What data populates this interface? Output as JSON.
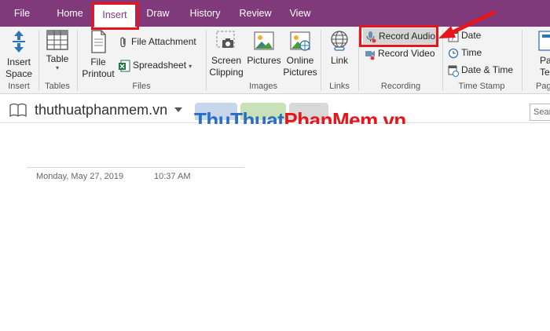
{
  "tabs": [
    {
      "label": "File"
    },
    {
      "label": "Home"
    },
    {
      "label": "Insert"
    },
    {
      "label": "Draw"
    },
    {
      "label": "History"
    },
    {
      "label": "Review"
    },
    {
      "label": "View"
    }
  ],
  "ribbon": {
    "insert_space": "Insert\nSpace",
    "table": "Table",
    "file_printout": "File\nPrintout",
    "file_attachment": "File Attachment",
    "spreadsheet": "Spreadsheet",
    "screen_clipping": "Screen\nClipping",
    "pictures": "Pictures",
    "online_pictures": "Online\nPictures",
    "link": "Link",
    "record_audio": "Record Audio",
    "record_video": "Record Video",
    "date": "Date",
    "time": "Time",
    "date_time": "Date & Time",
    "page_templates": "Pa\nTemp",
    "groups": {
      "insert": "Insert",
      "tables": "Tables",
      "files": "Files",
      "images": "Images",
      "links": "Links",
      "recording": "Recording",
      "timestamp": "Time Stamp",
      "pages": "Pag"
    }
  },
  "notebook": {
    "name": "thuthuatphanmem.vn",
    "search_placeholder": "Sear"
  },
  "watermark": {
    "part1": "Thu",
    "part2": "Thuat",
    "part3": "Phan",
    "part4": "Mem",
    "part5": ".vn"
  },
  "page": {
    "date": "Monday, May 27, 2019",
    "time": "10:37 AM"
  },
  "colors": {
    "accent": "#80397b",
    "highlight": "#e8141b"
  }
}
